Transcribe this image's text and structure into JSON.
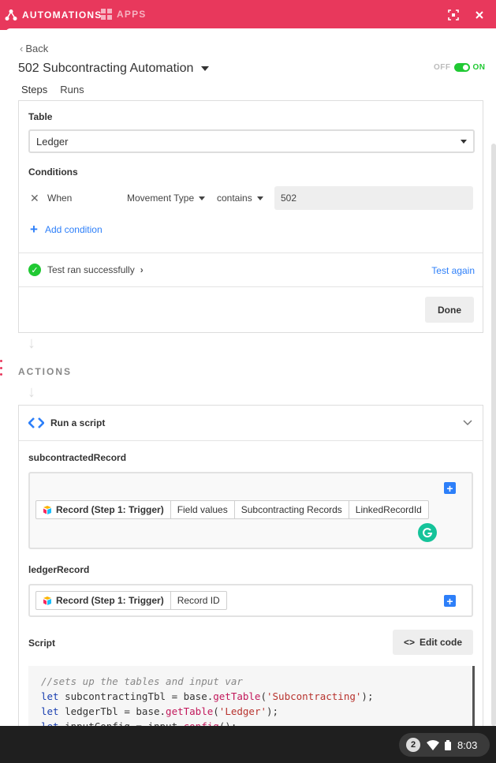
{
  "topbar": {
    "automations_label": "AUTOMATIONS",
    "apps_label": "APPS"
  },
  "header": {
    "back_label": "Back",
    "title": "502 Subcontracting Automation",
    "toggle_off": "OFF",
    "toggle_on": "ON",
    "toggle_state": "on"
  },
  "tabs": [
    {
      "label": "Steps",
      "active": true
    },
    {
      "label": "Runs",
      "active": false
    }
  ],
  "trigger": {
    "table_label": "Table",
    "table_value": "Ledger",
    "conditions_label": "Conditions",
    "condition": {
      "prefix": "When",
      "field": "Movement Type",
      "operator": "contains",
      "value": "502"
    },
    "add_condition": "Add condition",
    "test_status": "Test ran successfully",
    "test_again": "Test again",
    "done": "Done"
  },
  "actions_heading": "ACTIONS",
  "action": {
    "title": "Run a script",
    "input1": {
      "label": "subcontractedRecord",
      "tokens": [
        "Record (Step 1: Trigger)",
        "Field values",
        "Subcontracting Records",
        "LinkedRecordId"
      ]
    },
    "input2": {
      "label": "ledgerRecord",
      "tokens": [
        "Record (Step 1: Trigger)",
        "Record ID"
      ]
    },
    "script_label": "Script",
    "edit_code": "Edit code",
    "code_lines": [
      "//sets up the tables and input var",
      "let subcontractingTbl = base.getTable('Subcontracting');",
      "let ledgerTbl = base.getTable('Ledger');",
      "let inputConfig = input.config();"
    ]
  },
  "taskbar": {
    "notification_count": "2",
    "time": "8:03"
  },
  "colors": {
    "brand": "#e8385c",
    "accent": "#2d7ff9",
    "success": "#20c933"
  }
}
